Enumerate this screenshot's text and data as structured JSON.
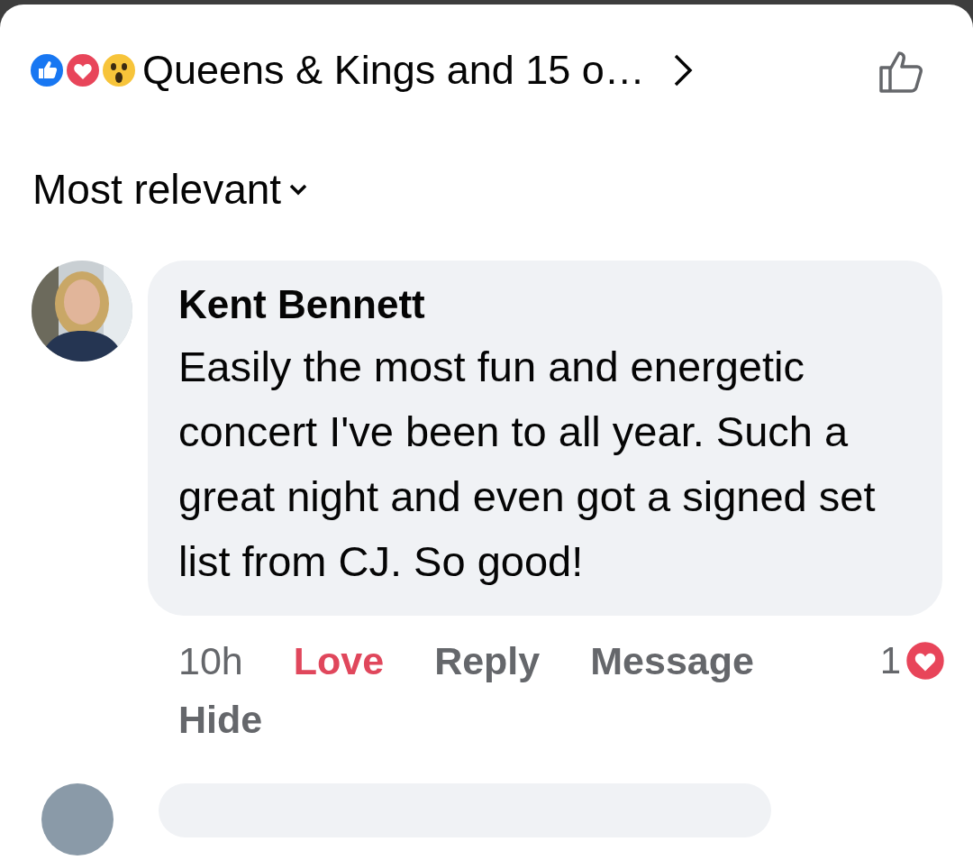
{
  "reactions_summary": {
    "reactions": [
      {
        "kind": "like"
      },
      {
        "kind": "love"
      },
      {
        "kind": "wow"
      }
    ],
    "text": "Queens & Kings and 15 o…"
  },
  "sort": {
    "label": "Most relevant"
  },
  "comments": [
    {
      "author": "Kent Bennett",
      "text": "Easily the most fun and energetic concert I've been to all year. Such a great night and even got a signed set list from CJ. So good!",
      "actions": [
        {
          "kind": "time",
          "label": "10h"
        },
        {
          "kind": "reaction",
          "label": "Love",
          "selected": true
        },
        {
          "kind": "action",
          "label": "Reply"
        },
        {
          "kind": "action",
          "label": "Message"
        },
        {
          "kind": "action",
          "label": "Hide"
        }
      ],
      "reaction_count": {
        "count": "1",
        "kind": "love"
      }
    }
  ]
}
